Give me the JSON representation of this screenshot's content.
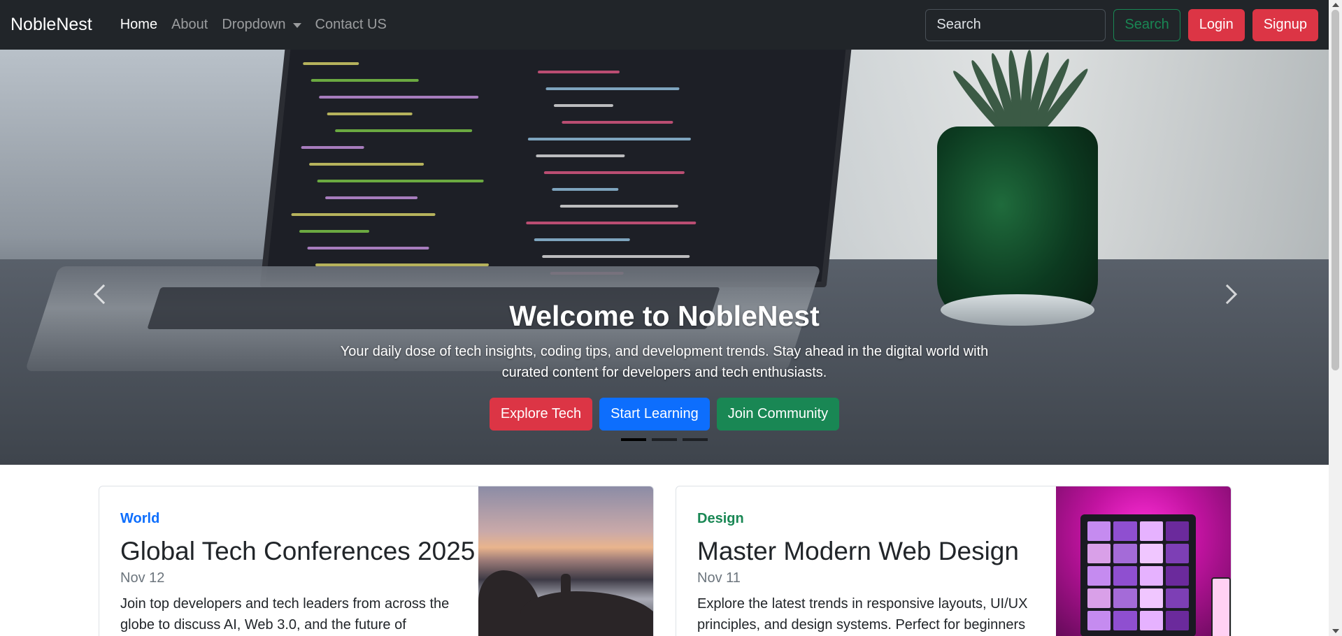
{
  "navbar": {
    "brand": "NobleNest",
    "links": [
      {
        "label": "Home",
        "active": true
      },
      {
        "label": "About",
        "active": false
      },
      {
        "label": "Dropdown",
        "active": false,
        "has_caret": true
      },
      {
        "label": "Contact US",
        "active": false
      }
    ],
    "search_placeholder": "Search",
    "search_button": "Search",
    "login_button": "Login",
    "signup_button": "Signup"
  },
  "hero": {
    "title": "Welcome to NobleNest",
    "text": "Your daily dose of tech insights, coding tips, and development trends. Stay ahead in the digital world with curated content for developers and tech enthusiasts.",
    "buttons": {
      "explore": "Explore Tech",
      "learn": "Start Learning",
      "community": "Join Community"
    },
    "slide_count": 3,
    "active_slide": 1
  },
  "cards": [
    {
      "category": "World",
      "category_color": "#0d6efd",
      "title": "Global Tech Conferences 2025",
      "date": "Nov 12",
      "text": "Join top developers and tech leaders from across the globe to discuss AI, Web 3.0, and the future of"
    },
    {
      "category": "Design",
      "category_color": "#198754",
      "title": "Master Modern Web Design",
      "date": "Nov 11",
      "text": "Explore the latest trends in responsive layouts, UI/UX principles, and design systems. Perfect for beginners"
    }
  ],
  "colors": {
    "navbar_bg": "#212529",
    "danger": "#dc3545",
    "primary": "#0d6efd",
    "success": "#198754"
  }
}
